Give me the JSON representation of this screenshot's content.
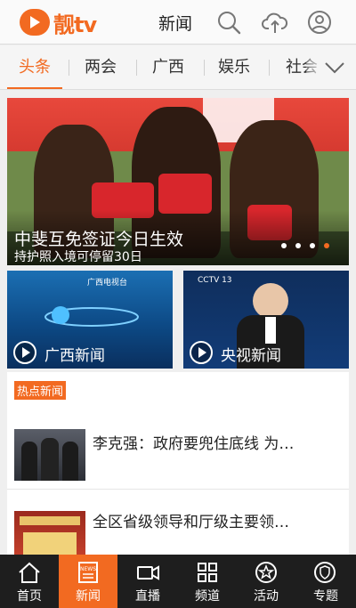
{
  "app": {
    "logo_text": "靓tv",
    "header_title": "新闻"
  },
  "tabs": [
    {
      "label": "头条",
      "active": true
    },
    {
      "label": "两会",
      "active": false
    },
    {
      "label": "广西",
      "active": false
    },
    {
      "label": "娱乐",
      "active": false
    },
    {
      "label": "社会",
      "active": false
    }
  ],
  "hero": {
    "title": "中斐互免签证今日生效",
    "subtitle": "持护照入境可停留30日",
    "slide_count": 4,
    "active_slide": 4
  },
  "video_tiles": [
    {
      "label": "广西新闻",
      "logo": "广西电视台"
    },
    {
      "label": "央视新闻",
      "logo": "CCTV 13"
    }
  ],
  "hot_news": {
    "badge": "热点新闻",
    "items": [
      {
        "title": "李克强：政府要兜住底线 为…"
      },
      {
        "title": "全区省级领导和厅级主要领…"
      }
    ]
  },
  "bottom_nav": [
    {
      "label": "首页",
      "icon": "home-icon",
      "active": false
    },
    {
      "label": "新闻",
      "icon": "news-icon",
      "active": true
    },
    {
      "label": "直播",
      "icon": "video-camera-icon",
      "active": false
    },
    {
      "label": "频道",
      "icon": "grid-icon",
      "active": false
    },
    {
      "label": "活动",
      "icon": "star-badge-icon",
      "active": false
    },
    {
      "label": "专题",
      "icon": "shield-badge-icon",
      "active": false
    }
  ],
  "colors": {
    "accent": "#f26a21",
    "nav_bg": "#1e1e1e"
  }
}
